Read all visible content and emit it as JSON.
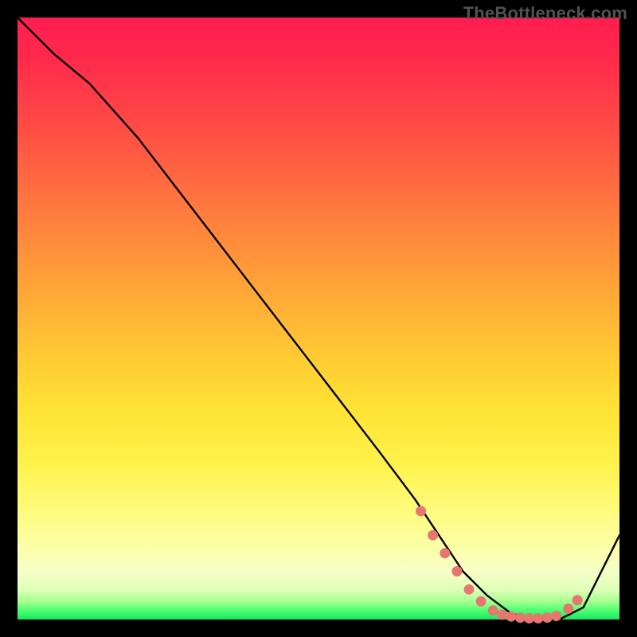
{
  "watermark": "TheBottleneck.com",
  "chart_data": {
    "type": "line",
    "title": "",
    "xlabel": "",
    "ylabel": "",
    "xlim": [
      0,
      100
    ],
    "ylim": [
      0,
      100
    ],
    "series": [
      {
        "name": "bottleneck-curve",
        "x": [
          0,
          6,
          12,
          20,
          30,
          40,
          50,
          60,
          66,
          70,
          74,
          78,
          82,
          86,
          90,
          94,
          100
        ],
        "y": [
          100,
          94,
          89,
          80,
          67,
          54,
          41,
          28,
          20,
          14,
          8,
          4,
          1,
          0,
          0,
          2,
          14
        ]
      }
    ],
    "markers": {
      "name": "trough-dots",
      "color": "#e7766f",
      "x": [
        67,
        69,
        71,
        73,
        75,
        77,
        79,
        80.5,
        82,
        83.5,
        85,
        86.5,
        88,
        89.5,
        91.5,
        93
      ],
      "y": [
        18,
        14,
        11,
        8,
        5,
        3,
        1.5,
        0.8,
        0.5,
        0.3,
        0.2,
        0.2,
        0.3,
        0.6,
        1.8,
        3.2
      ]
    },
    "gradient_stops": [
      {
        "t": 0.0,
        "color": "#ff1d4f"
      },
      {
        "t": 0.18,
        "color": "#ff4b45"
      },
      {
        "t": 0.44,
        "color": "#ffa238"
      },
      {
        "t": 0.65,
        "color": "#ffe335"
      },
      {
        "t": 0.88,
        "color": "#fdffa8"
      },
      {
        "t": 0.97,
        "color": "#a6ff8e"
      },
      {
        "t": 1.0,
        "color": "#17e85f"
      }
    ]
  }
}
